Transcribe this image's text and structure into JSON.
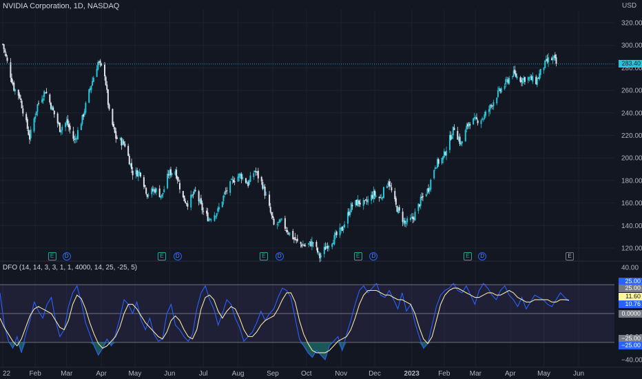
{
  "header": {
    "title": "NVIDIA Corporation, 1D, NASDAQ",
    "currency": "USD"
  },
  "chart_data": [
    {
      "type": "candlestick",
      "title": "NVIDIA Corporation, 1D, NASDAQ",
      "ylabel": "USD",
      "y_ticks": [
        "320.00",
        "300.00",
        "280.00",
        "260.00",
        "240.00",
        "220.00",
        "200.00",
        "180.00",
        "160.00",
        "140.00",
        "120.00"
      ],
      "ylim": [
        108,
        333
      ],
      "last_price": 283.4,
      "last_price_label": "283.40",
      "close_path": [
        [
          "2022-01-03",
          301
        ],
        [
          "2022-01-07",
          285
        ],
        [
          "2022-01-13",
          262
        ],
        [
          "2022-01-18",
          255
        ],
        [
          "2022-01-27",
          218
        ],
        [
          "2022-02-03",
          247
        ],
        [
          "2022-02-10",
          260
        ],
        [
          "2022-02-16",
          244
        ],
        [
          "2022-02-23",
          226
        ],
        [
          "2022-03-01",
          232
        ],
        [
          "2022-03-08",
          215
        ],
        [
          "2022-03-15",
          235
        ],
        [
          "2022-03-22",
          262
        ],
        [
          "2022-03-29",
          285
        ],
        [
          "2022-04-04",
          275
        ],
        [
          "2022-04-08",
          240
        ],
        [
          "2022-04-14",
          218
        ],
        [
          "2022-04-22",
          212
        ],
        [
          "2022-04-29",
          187
        ],
        [
          "2022-05-06",
          187
        ],
        [
          "2022-05-12",
          168
        ],
        [
          "2022-05-19",
          172
        ],
        [
          "2022-05-25",
          166
        ],
        [
          "2022-05-31",
          186
        ],
        [
          "2022-06-06",
          189
        ],
        [
          "2022-06-13",
          164
        ],
        [
          "2022-06-17",
          160
        ],
        [
          "2022-06-24",
          170
        ],
        [
          "2022-07-01",
          152
        ],
        [
          "2022-07-06",
          146
        ],
        [
          "2022-07-14",
          153
        ],
        [
          "2022-07-20",
          168
        ],
        [
          "2022-07-28",
          181
        ],
        [
          "2022-08-03",
          185
        ],
        [
          "2022-08-10",
          177
        ],
        [
          "2022-08-16",
          189
        ],
        [
          "2022-08-23",
          176
        ],
        [
          "2022-08-29",
          155
        ],
        [
          "2022-09-02",
          140
        ],
        [
          "2022-09-09",
          143
        ],
        [
          "2022-09-16",
          133
        ],
        [
          "2022-09-23",
          125
        ],
        [
          "2022-09-30",
          122
        ],
        [
          "2022-10-07",
          125
        ],
        [
          "2022-10-13",
          112
        ],
        [
          "2022-10-19",
          122
        ],
        [
          "2022-10-26",
          129
        ],
        [
          "2022-11-02",
          137
        ],
        [
          "2022-11-10",
          157
        ],
        [
          "2022-11-16",
          161
        ],
        [
          "2022-11-22",
          159
        ],
        [
          "2022-11-30",
          168
        ],
        [
          "2022-12-06",
          164
        ],
        [
          "2022-12-13",
          180
        ],
        [
          "2022-12-20",
          157
        ],
        [
          "2022-12-28",
          142
        ],
        [
          "2023-01-04",
          146
        ],
        [
          "2023-01-11",
          162
        ],
        [
          "2023-01-18",
          173
        ],
        [
          "2023-01-24",
          194
        ],
        [
          "2023-01-31",
          200
        ],
        [
          "2023-02-06",
          217
        ],
        [
          "2023-02-10",
          227
        ],
        [
          "2023-02-16",
          212
        ],
        [
          "2023-02-23",
          232
        ],
        [
          "2023-03-01",
          233
        ],
        [
          "2023-03-08",
          236
        ],
        [
          "2023-03-14",
          245
        ],
        [
          "2023-03-20",
          256
        ],
        [
          "2023-03-27",
          265
        ],
        [
          "2023-04-03",
          275
        ],
        [
          "2023-04-10",
          270
        ],
        [
          "2023-04-17",
          271
        ],
        [
          "2023-04-24",
          268
        ],
        [
          "2023-05-01",
          282
        ],
        [
          "2023-05-05",
          287
        ],
        [
          "2023-05-10",
          288
        ],
        [
          "2023-05-12",
          283.4
        ]
      ],
      "events": [
        {
          "date": "2022-02-16",
          "label": "E",
          "kind": "earnings"
        },
        {
          "date": "2022-03-01",
          "label": "D",
          "kind": "dividend"
        },
        {
          "date": "2022-05-25",
          "label": "E",
          "kind": "earnings"
        },
        {
          "date": "2022-06-08",
          "label": "D",
          "kind": "dividend"
        },
        {
          "date": "2022-08-24",
          "label": "E",
          "kind": "earnings"
        },
        {
          "date": "2022-09-07",
          "label": "D",
          "kind": "dividend"
        },
        {
          "date": "2022-11-16",
          "label": "E",
          "kind": "earnings"
        },
        {
          "date": "2022-11-30",
          "label": "D",
          "kind": "dividend"
        },
        {
          "date": "2023-02-22",
          "label": "E",
          "kind": "earnings"
        },
        {
          "date": "2023-03-07",
          "label": "D",
          "kind": "dividend"
        },
        {
          "date": "2023-05-24",
          "label": "E",
          "kind": "earnings-upcoming"
        }
      ],
      "colors": {
        "up": "#26c6da",
        "down": "#e0e3eb",
        "price_line": "#26c6da",
        "grid": "#1e222d"
      }
    },
    {
      "type": "line",
      "title": "DFO (14, 14, 3, 3, 1, 1, 4000, 14, 25, -25, 5)",
      "y_ticks": [
        "40.00",
        "−20.00",
        "−40.00"
      ],
      "ylim": [
        -44,
        42
      ],
      "levels": {
        "upper": 25,
        "zero": 0,
        "lower": -25
      },
      "badges": [
        {
          "label": "25.00",
          "value": 25,
          "bg": "#2962ff",
          "fg": "#ffffff"
        },
        {
          "label": "25.00",
          "value": 25,
          "bg": "#787b86",
          "fg": "#ffffff"
        },
        {
          "label": "11.60",
          "value": 11.6,
          "bg": "#fff59d",
          "fg": "#131722"
        },
        {
          "label": "10.76",
          "value": 10.76,
          "bg": "#2962ff",
          "fg": "#ffffff"
        },
        {
          "label": "0.0000",
          "value": 0,
          "bg": "#787b86",
          "fg": "#ffffff"
        },
        {
          "label": "−25.00",
          "value": -25,
          "bg": "#787b86",
          "fg": "#ffffff"
        },
        {
          "label": "−25.00",
          "value": -25,
          "bg": "#2962ff",
          "fg": "#ffffff"
        }
      ],
      "series": [
        {
          "color": "#2962ff",
          "values": [
            18,
            -10,
            -24,
            -30,
            -20,
            -34,
            -18,
            -6,
            10,
            2,
            -4,
            8,
            14,
            -6,
            -20,
            -14,
            6,
            18,
            24,
            10,
            -8,
            -18,
            -28,
            -36,
            -30,
            -22,
            -28,
            -18,
            -4,
            12,
            8,
            0,
            10,
            -6,
            -14,
            -4,
            -18,
            -24,
            -22,
            0,
            8,
            -10,
            -14,
            -20,
            -24,
            -18,
            4,
            18,
            24,
            12,
            4,
            -10,
            0,
            12,
            8,
            -4,
            -12,
            -24,
            -20,
            -16,
            -8,
            2,
            -6,
            0,
            4,
            14,
            22,
            20,
            14,
            -4,
            -22,
            -28,
            -34,
            -38,
            -32,
            -36,
            -40,
            -28,
            -24,
            -20,
            -32,
            -18,
            -6,
            8,
            20,
            24,
            18,
            22,
            26,
            16,
            14,
            20,
            12,
            4,
            18,
            2,
            8,
            -8,
            -20,
            -30,
            -26,
            -10,
            6,
            16,
            20,
            22,
            26,
            20,
            18,
            24,
            16,
            8,
            20,
            26,
            22,
            16,
            12,
            20,
            24,
            16,
            12,
            6,
            14,
            4,
            10,
            16,
            14,
            12,
            8,
            6,
            12,
            18,
            14,
            10.76
          ]
        },
        {
          "color": "#f4e9a6",
          "values": [
            -4,
            -12,
            -18,
            -24,
            -28,
            -22,
            -12,
            -2,
            4,
            6,
            4,
            2,
            0,
            -6,
            -12,
            -14,
            -6,
            8,
            16,
            13,
            4,
            -8,
            -18,
            -26,
            -30,
            -28,
            -24,
            -20,
            -12,
            0,
            8,
            8,
            4,
            -2,
            -8,
            -12,
            -16,
            -20,
            -22,
            -16,
            -6,
            -2,
            -6,
            -14,
            -20,
            -22,
            -14,
            4,
            14,
            16,
            12,
            2,
            -4,
            2,
            6,
            4,
            -4,
            -14,
            -20,
            -20,
            -16,
            -10,
            -6,
            -4,
            -2,
            4,
            12,
            18,
            18,
            10,
            -6,
            -18,
            -26,
            -32,
            -34,
            -34,
            -34,
            -32,
            -28,
            -24,
            -22,
            -20,
            -14,
            -4,
            8,
            16,
            20,
            20,
            20,
            18,
            16,
            16,
            14,
            12,
            12,
            10,
            8,
            0,
            -12,
            -22,
            -26,
            -20,
            -6,
            8,
            16,
            20,
            22,
            22,
            20,
            18,
            16,
            14,
            14,
            16,
            18,
            18,
            16,
            16,
            18,
            20,
            18,
            14,
            12,
            10,
            10,
            12,
            12,
            12,
            12,
            10,
            10,
            12,
            12,
            11.6
          ]
        }
      ]
    }
  ],
  "x_ticks": [
    "22",
    "Feb",
    "Mar",
    "Apr",
    "May",
    "Jun",
    "Jul",
    "Aug",
    "Sep",
    "Oct",
    "Nov",
    "Dec",
    "2023",
    "Feb",
    "Mar",
    "Apr",
    "May",
    "Jun"
  ]
}
